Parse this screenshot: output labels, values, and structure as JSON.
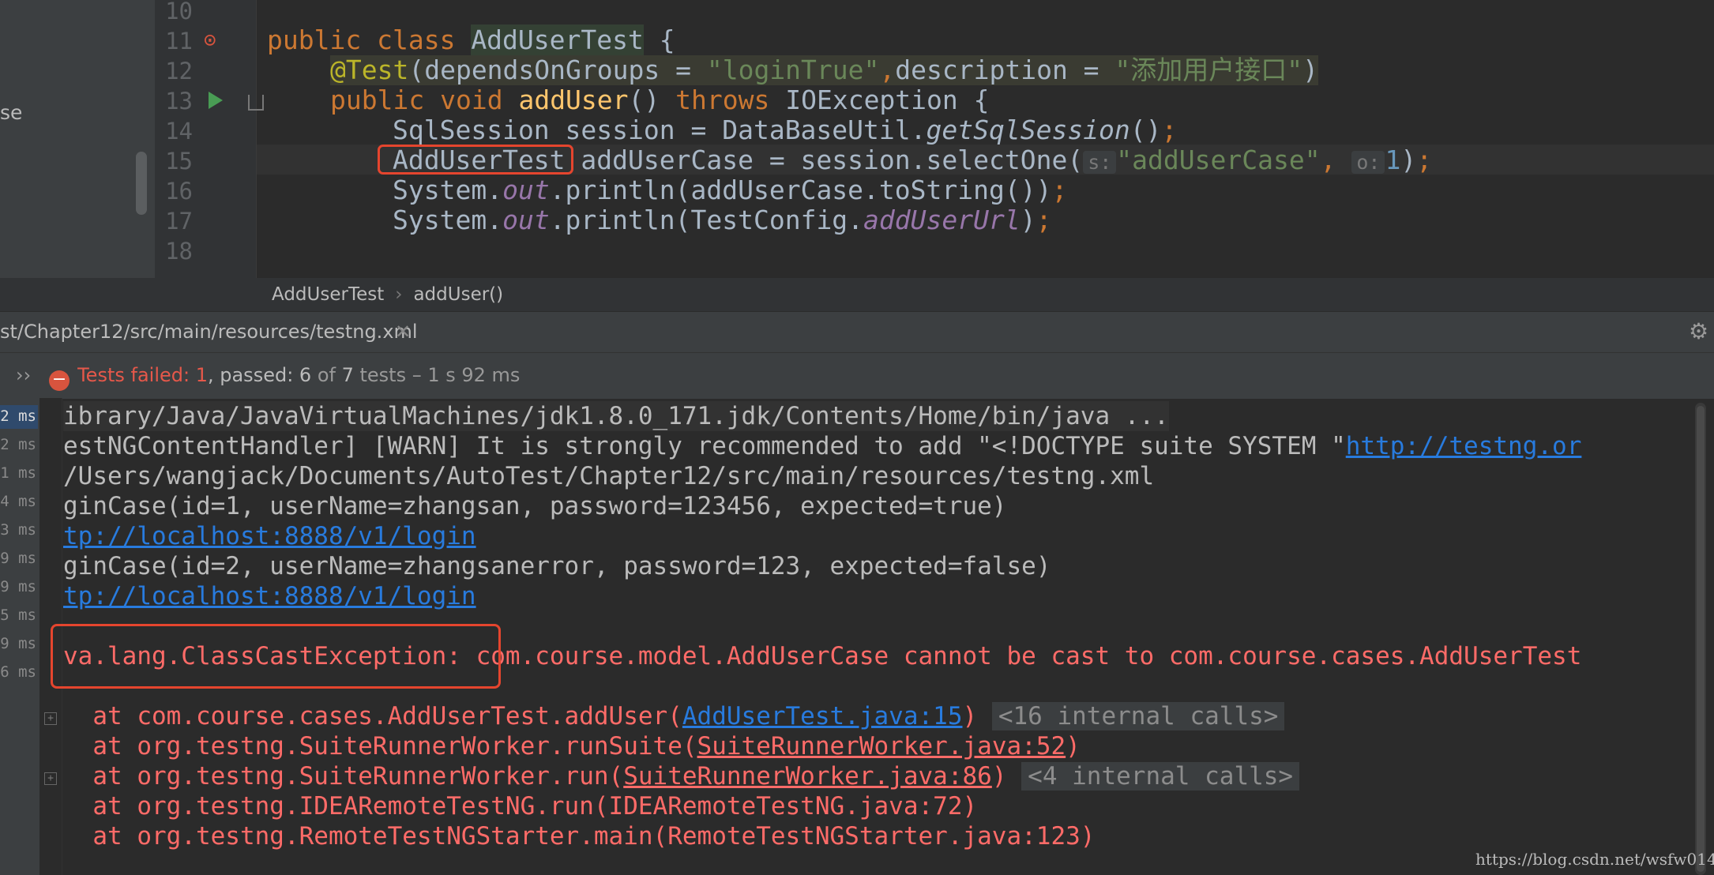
{
  "sidebar": {
    "label": "se"
  },
  "editor": {
    "line_numbers": [
      "10",
      "11",
      "12",
      "13",
      "14",
      "15",
      "16",
      "17",
      "18"
    ],
    "lines": {
      "l11": {
        "kw1": "public",
        "kw2": "class",
        "cls": "AddUserTest",
        "rest": " {"
      },
      "l12": {
        "ann": "@Test",
        "p1": "(dependsOnGroups = ",
        "s1": "\"loginTrue\"",
        "comma": ",",
        "p2": "description = ",
        "s2": "\"添加用户接口\"",
        "p3": ")"
      },
      "l13": {
        "kw1": "public",
        "kw2": "void",
        "fn": "addUser",
        "p1": "() ",
        "kw3": "throws",
        "p2": " IOException {"
      },
      "l14": {
        "p1": "SqlSession session = DataBaseUtil.",
        "it": "getSqlSession",
        "p2": "()",
        "semi": ";"
      },
      "l15": {
        "boxed": "AddUserTest",
        "p1": " addUserCase = session.selectOne(",
        "h1": "s:",
        "s1": "\"addUserCase\"",
        "comma": ",",
        "h2": "o:",
        "n1": "1",
        "p2": ")",
        "semi": ";"
      },
      "l16": {
        "p1": "System.",
        "st": "out",
        "p2": ".println(addUserCase.toString())",
        "semi": ";"
      },
      "l17": {
        "p1": "System.",
        "st": "out",
        "p2": ".println(TestConfig.",
        "st2": "addUserUrl",
        "p3": ")",
        "semi": ";"
      }
    }
  },
  "breadcrumb": {
    "class": "AddUserTest",
    "method": "addUser()"
  },
  "run_tab": {
    "label": "st/Chapter12/src/main/resources/testng.xml"
  },
  "status": {
    "failed_label": "Tests failed: ",
    "failed": "1",
    "passed_label": ", passed: ",
    "passed": "6",
    "of_label": " of ",
    "total": "7",
    "tests_label": " tests",
    "duration": " – 1 s 92 ms"
  },
  "timings": [
    "2 ms",
    "2 ms",
    "1 ms",
    "4 ms",
    "3 ms",
    "9 ms",
    "9 ms",
    "5 ms",
    "9 ms",
    "6 ms"
  ],
  "console": {
    "c1": "ibrary/Java/JavaVirtualMachines/jdk1.8.0_171.jdk/Contents/Home/bin/java ...",
    "c2": "estNGContentHandler] [WARN] It is strongly recommended to add \"<!DOCTYPE suite SYSTEM \"",
    "c2_link": "http://testng.or",
    "c3": "/Users/wangjack/Documents/AutoTest/Chapter12/src/main/resources/testng.xml",
    "c4": "ginCase(id=1, userName=zhangsan, password=123456, expected=true)",
    "c5": "tp://localhost:8888/v1/login",
    "c6": "ginCase(id=2, userName=zhangsanerror, password=123, expected=false)",
    "c7": "tp://localhost:8888/v1/login",
    "exc": "va.lang.ClassCastException:",
    "exc_msg": " com.course.model.AddUserCase cannot be cast to com.course.cases.AddUserTest",
    "t1": "  at com.course.cases.AddUserTest.addUser(",
    "t1_link": "AddUserTest.java:15",
    "t1_end": ")",
    "t1_calls": "<16 internal calls>",
    "t2": "  at org.testng.SuiteRunnerWorker.runSuite(",
    "t2_link": "SuiteRunnerWorker.java:52",
    "t2_end": ")",
    "t3": "  at org.testng.SuiteRunnerWorker.run(",
    "t3_link": "SuiteRunnerWorker.java:86",
    "t3_end": ")",
    "t3_calls": "<4 internal calls>",
    "t4": "  at org.testng.IDEARemoteTestNG.run(IDEARemoteTestNG.java:72)",
    "t5": "  at org.testng.RemoteTestNGStarter.main(RemoteTestNGStarter.java:123)"
  },
  "watermark": "https://blog.csdn.net/wsfw014"
}
